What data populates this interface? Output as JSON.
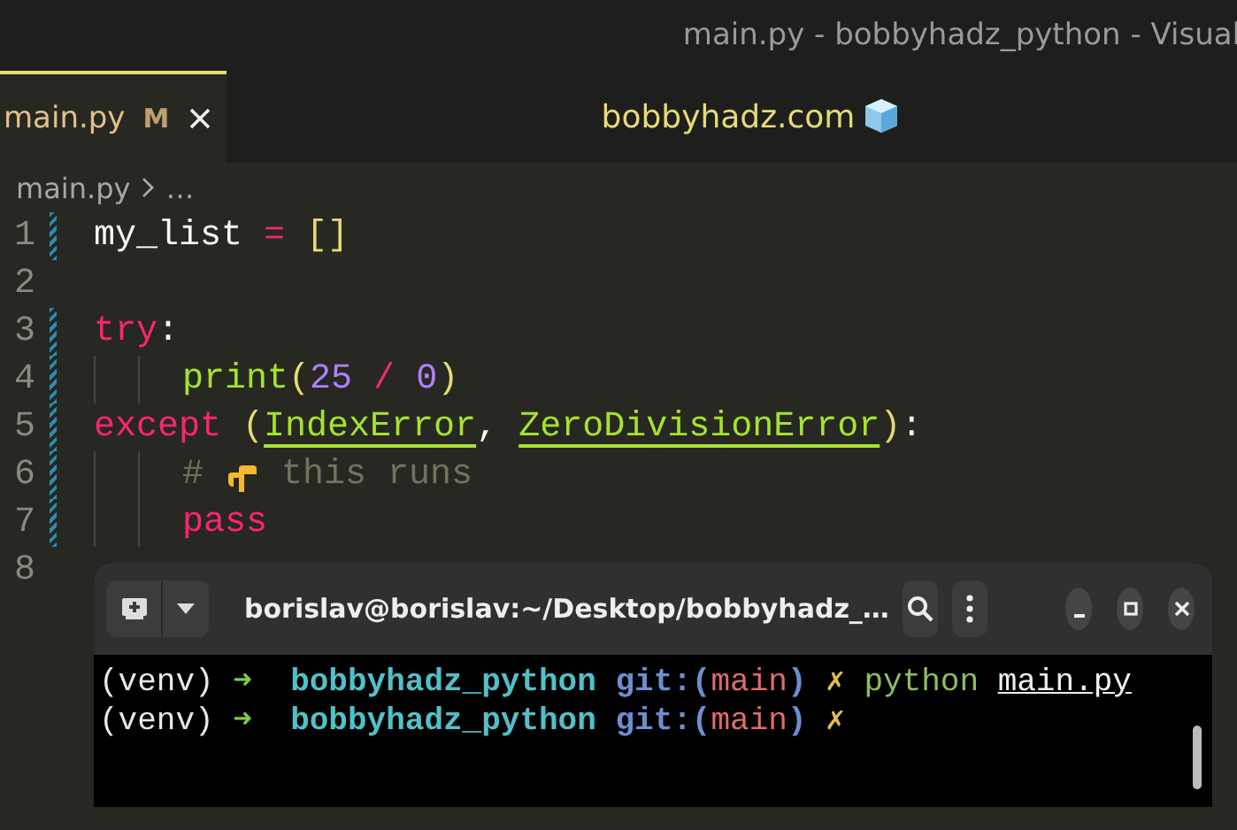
{
  "window": {
    "title": "main.py - bobbyhadz_python - Visual"
  },
  "tabs": [
    {
      "label": "main.py",
      "badge": "M",
      "selected": true
    }
  ],
  "banner": {
    "text": "bobbyhadz.com"
  },
  "breadcrumb": {
    "file": "main.py",
    "more": "…"
  },
  "editor": {
    "lines": [
      {
        "number": "1",
        "modified": true,
        "indented": false,
        "tokens": [
          {
            "text": "my_list ",
            "kind": "plain"
          },
          {
            "text": "= ",
            "kind": "keyword"
          },
          {
            "text": "[]",
            "kind": "bracket"
          }
        ]
      },
      {
        "number": "2",
        "modified": false,
        "indented": false
      },
      {
        "number": "3",
        "modified": true,
        "indented": false,
        "tokens": [
          {
            "text": "try",
            "kind": "keyword"
          },
          {
            "text": ":",
            "kind": "plain"
          }
        ]
      },
      {
        "number": "4",
        "modified": true,
        "indented": true,
        "tokens": [
          {
            "text": "print",
            "kind": "function"
          },
          {
            "text": "(",
            "kind": "bracket"
          },
          {
            "text": "25 ",
            "kind": "number"
          },
          {
            "text": "/ ",
            "kind": "keyword"
          },
          {
            "text": "0",
            "kind": "number"
          },
          {
            "text": ")",
            "kind": "bracket"
          }
        ]
      },
      {
        "number": "5",
        "modified": true,
        "indented": false,
        "tokens": [
          {
            "text": "except ",
            "kind": "keyword"
          },
          {
            "text": "(",
            "kind": "bracket"
          },
          {
            "text": "IndexError",
            "kind": "class"
          },
          {
            "text": ", ",
            "kind": "plain"
          },
          {
            "text": "ZeroDivisionError",
            "kind": "class"
          },
          {
            "text": ")",
            "kind": "bracket"
          },
          {
            "text": ":",
            "kind": "plain"
          }
        ]
      },
      {
        "number": "6",
        "modified": true,
        "indented": true,
        "tokens": [
          {
            "text": "# ",
            "kind": "comment"
          },
          {
            "kind": "hand-emoji"
          },
          {
            "text": " this runs",
            "kind": "comment"
          }
        ]
      },
      {
        "number": "7",
        "modified": true,
        "indented": true,
        "tokens": [
          {
            "text": "pass",
            "kind": "keyword"
          }
        ]
      },
      {
        "number": "8",
        "modified": false,
        "indented": false
      }
    ]
  },
  "terminal": {
    "title": "borislav@borislav:~/Desktop/bobbyhadz_…",
    "lines": [
      {
        "segments": [
          {
            "text": "(venv) ",
            "kind": "plain"
          },
          {
            "text": "➜  ",
            "kind": "arrow"
          },
          {
            "text": "bobbyhadz_python ",
            "kind": "dir"
          },
          {
            "text": "git:(",
            "kind": "git"
          },
          {
            "text": "main",
            "kind": "branch"
          },
          {
            "text": ") ",
            "kind": "git"
          },
          {
            "text": "✗ ",
            "kind": "dirty"
          },
          {
            "text": "python ",
            "kind": "command"
          },
          {
            "text": "main.py",
            "kind": "argument"
          }
        ]
      },
      {
        "segments": [
          {
            "text": "(venv) ",
            "kind": "plain"
          },
          {
            "text": "➜  ",
            "kind": "arrow"
          },
          {
            "text": "bobbyhadz_python ",
            "kind": "dir"
          },
          {
            "text": "git:(",
            "kind": "git"
          },
          {
            "text": "main",
            "kind": "branch"
          },
          {
            "text": ") ",
            "kind": "git"
          },
          {
            "text": "✗",
            "kind": "dirty"
          }
        ]
      }
    ]
  }
}
